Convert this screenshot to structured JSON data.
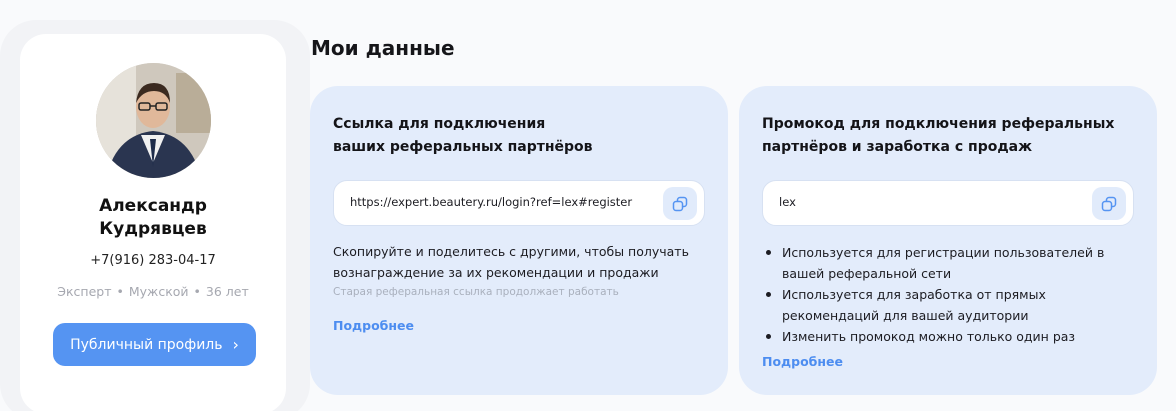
{
  "profile": {
    "name_line1": "Александр",
    "name_line2": "Кудрявцев",
    "phone": "+7(916) 283-04-17",
    "role": "Эксперт",
    "gender": "Мужской",
    "age": "36 лет",
    "separator": "•",
    "public_profile_button": "Публичный профиль",
    "button_chevron": "›"
  },
  "page": {
    "title": "Мои данные"
  },
  "referral_link": {
    "heading_line1": "Ссылка для подключения",
    "heading_line2": "ваших реферальных партнёров",
    "value": "https://expert.beautery.ru/login?ref=lex#register",
    "description": "Скопируйте и поделитесь с другими, чтобы получать вознаграждение за их рекомендации и продажи",
    "note": "Старая реферальная ссылка продолжает работать",
    "more_link": "Подробнее"
  },
  "promo_code": {
    "heading_line1": "Промокод для подключения реферальных",
    "heading_line2": "партнёров и заработка с продаж",
    "value": "lex",
    "bullets": [
      "Используется для регистрации пользователей в вашей реферальной сети",
      "Используется для заработка от прямых рекомендаций для вашей аудитории",
      "Изменить промокод можно только один раз"
    ],
    "more_link": "Подробнее"
  },
  "colors": {
    "accent": "#5594f2",
    "panel_bg": "#e3ecfb",
    "link": "#4d8df0"
  },
  "icons": {
    "copy": "copy-icon",
    "chevron": "chevron-right-icon"
  }
}
